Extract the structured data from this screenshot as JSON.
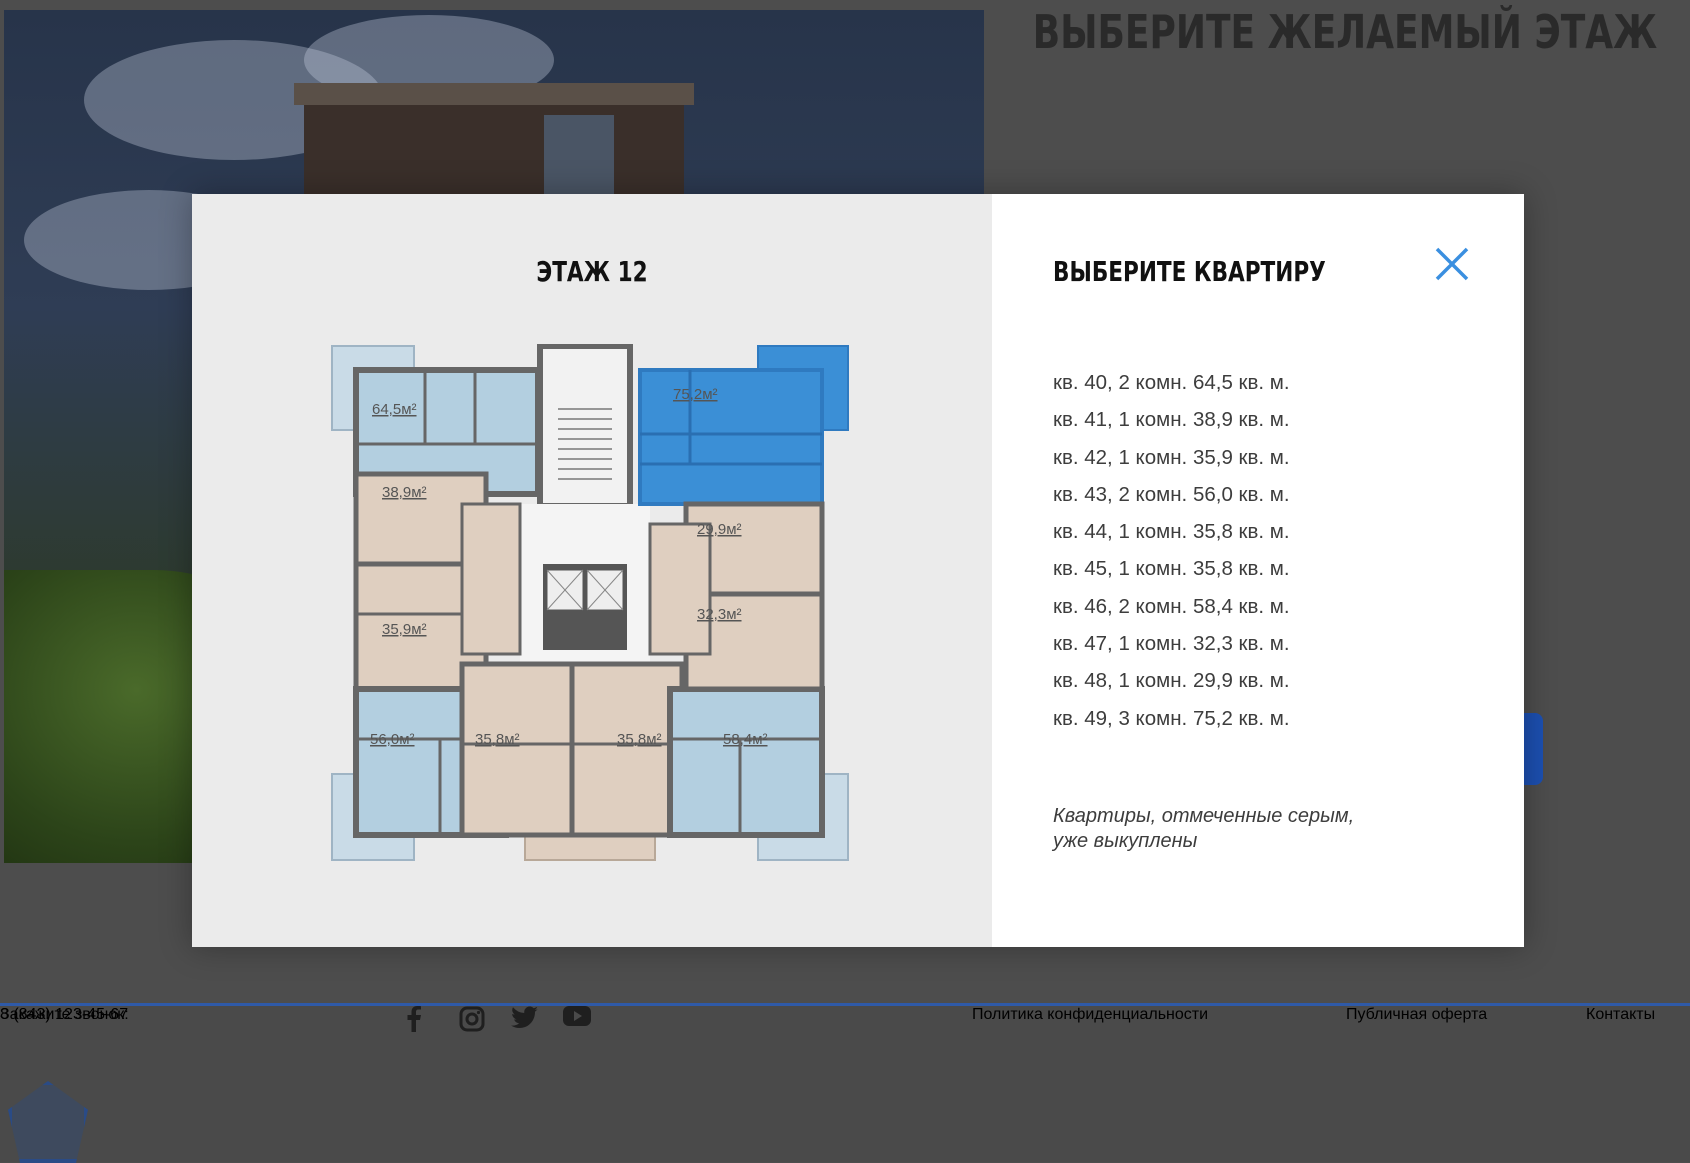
{
  "page": {
    "heading": "ВЫБЕРИТЕ ЖЕЛАЕМЫЙ ЭТАЖ"
  },
  "modal": {
    "floor_title": "ЭТАЖ 12",
    "choose_title": "ВЫБЕРИТЕ КВАРТИРУ",
    "apartments": [
      "кв. 40, 2 комн. 64,5 кв. м.",
      "кв. 41, 1 комн. 38,9 кв. м.",
      "кв. 42, 1 комн. 35,9 кв. м.",
      "кв. 43, 2 комн. 56,0 кв. м.",
      "кв. 44, 1 комн. 35,8 кв. м.",
      "кв. 45, 1 комн. 35,8 кв. м.",
      "кв. 46, 2 комн. 58,4 кв. м.",
      "кв. 47, 1 комн. 32,3 кв. м.",
      "кв. 48, 1 комн. 29,9 кв. м.",
      "кв. 49, 3 комн. 75,2 кв. м."
    ],
    "note": "Квартиры, отмеченные серым, уже выкуплены",
    "plan_labels": {
      "a40": "64,5м²",
      "a41": "38,9м²",
      "a42": "35,9м²",
      "a43": "56,0м²",
      "a44": "35,8м²",
      "a45": "35,8м²",
      "a46": "58,4м²",
      "a47": "32,3м²",
      "a48": "29,9м²",
      "a49": "75,2м²"
    },
    "colors": {
      "accent": "#3a8fe0",
      "highlight": "#3b8fd6",
      "blue_apartment": "#b3cfe0",
      "beige_apartment": "#dfcfc0"
    }
  },
  "footer": {
    "call_label": "Закажите звонок:",
    "phone": "8 (843) 123-45-67",
    "links": [
      "Политика конфиденциальности",
      "Публичная оферта",
      "Контакты"
    ],
    "social_icons": [
      "facebook-icon",
      "instagram-icon",
      "twitter-icon",
      "youtube-icon"
    ]
  }
}
